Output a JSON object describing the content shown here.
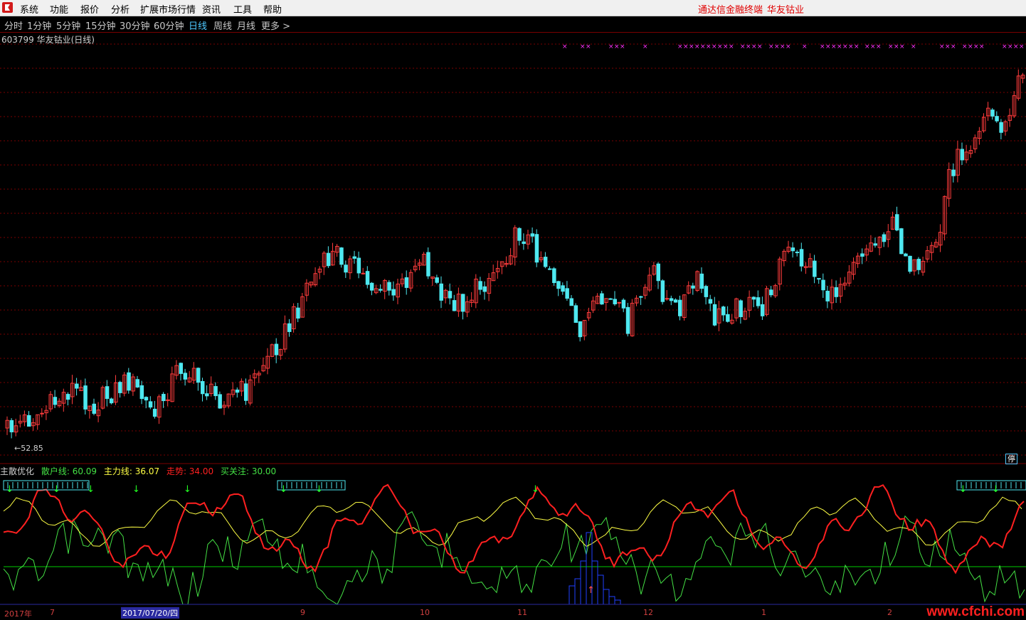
{
  "menu": {
    "items": [
      "系统",
      "功能",
      "报价",
      "分析",
      "扩展市场行情",
      "资讯",
      "工具",
      "帮助"
    ],
    "brand_terminal": "通达信金融终端",
    "brand_stock": "华友钴业"
  },
  "periods": {
    "items": [
      "分时",
      "1分钟",
      "5分钟",
      "15分钟",
      "30分钟",
      "60分钟",
      "日线",
      "周线",
      "月线",
      "更多 >"
    ],
    "active": "日线"
  },
  "chart": {
    "title": "603799 华友钴业(日线)",
    "low_label": "52.85",
    "stop_badge": "停",
    "colors": {
      "up": "#ff3c3c",
      "down": "#4ee8f0",
      "grid": "#7a0000",
      "signal": "#ff33ff"
    }
  },
  "indicator": {
    "name": "主散优化",
    "retail_line": "散户线: 60.09",
    "main_line": "主力线: 36.07",
    "trend": "走势: 34.00",
    "buy_watch": "买关注: 30.00",
    "colors": {
      "retail": "#44e044",
      "main": "#ffff44",
      "trend": "#ff2020",
      "buy": "#00cc00"
    }
  },
  "date_axis": {
    "ticks": [
      "2017年",
      "7",
      "9",
      "10",
      "11",
      "12",
      "1",
      "2"
    ],
    "current": "2017/07/20/四"
  },
  "watermark": "www.cfchi.com"
}
